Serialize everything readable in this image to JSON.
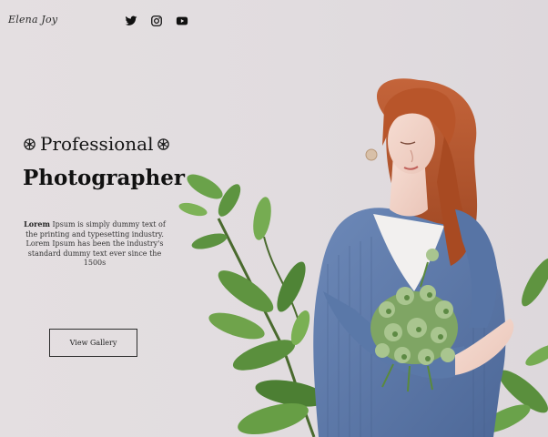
{
  "header": {
    "logo_text": "Elena Joy",
    "social": [
      {
        "icon": "twitter-icon"
      },
      {
        "icon": "instagram-icon"
      },
      {
        "icon": "youtube-icon"
      }
    ]
  },
  "hero": {
    "title_line1": "Professional",
    "title_line2": "Photographer",
    "description_bold": "Lorem",
    "description_rest": " Ipsum is simply dummy text of the printing and typesetting industry. Lorem Ipsum has been the industry's standard dummy text ever since the 1500s",
    "cta_label": "View Gallery"
  },
  "colors": {
    "background": "#e3dee0",
    "text_dark": "#111111",
    "sweater_blue": "#5b79a8",
    "hair": "#b5542a",
    "leaf_green": "#5f9440"
  }
}
